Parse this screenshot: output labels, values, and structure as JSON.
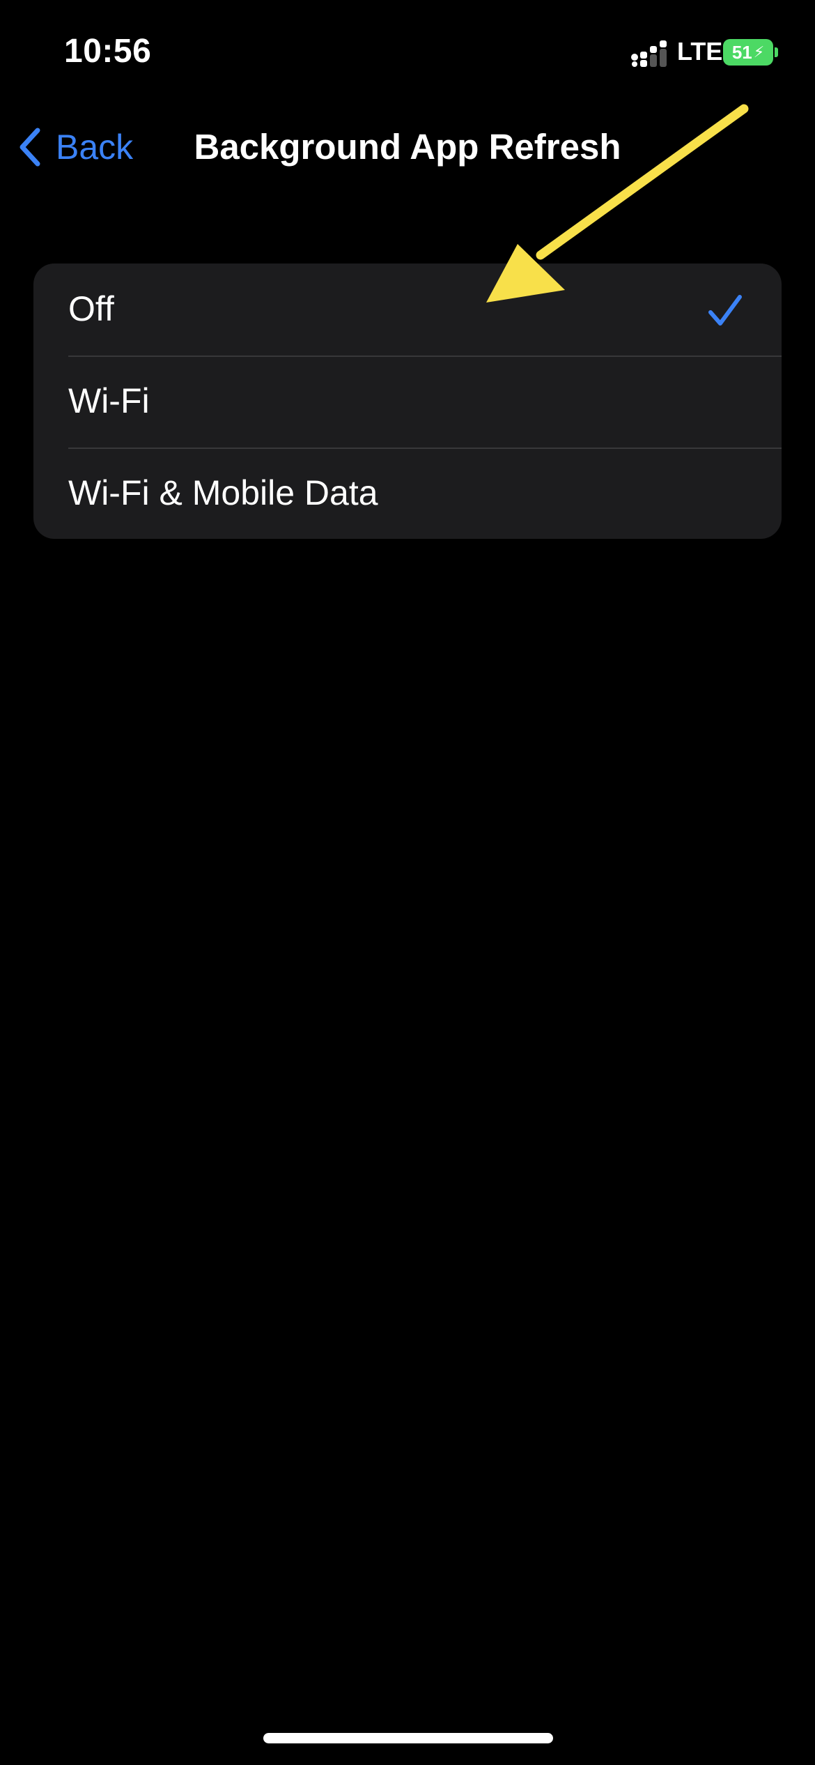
{
  "status_bar": {
    "time": "10:56",
    "network": "LTE",
    "battery_level": "51",
    "battery_icon": "charging-bolt",
    "battery_color": "#4cd964"
  },
  "nav": {
    "back_label": "Back",
    "title": "Background App Refresh",
    "accent_color": "#3b82f6"
  },
  "options": [
    {
      "label": "Off",
      "selected": true
    },
    {
      "label": "Wi-Fi",
      "selected": false
    },
    {
      "label": "Wi-Fi & Mobile Data",
      "selected": false
    }
  ],
  "annotation": {
    "icon": "arrow-icon",
    "color": "#f8e04a"
  }
}
